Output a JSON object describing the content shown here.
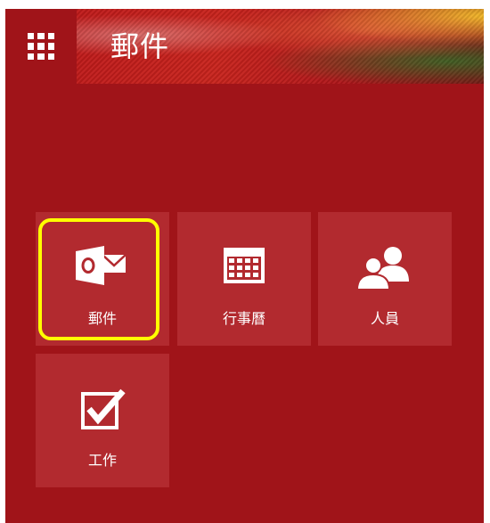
{
  "header": {
    "title": "郵件"
  },
  "tiles": [
    {
      "label": "郵件",
      "icon": "outlook-mail-icon"
    },
    {
      "label": "行事曆",
      "icon": "calendar-icon"
    },
    {
      "label": "人員",
      "icon": "people-icon"
    },
    {
      "label": "工作",
      "icon": "tasks-checkbox-icon"
    }
  ],
  "colors": {
    "background": "#a01419",
    "tile": "#b22a2f",
    "highlight": "#ffff00",
    "text": "#ffffff"
  }
}
